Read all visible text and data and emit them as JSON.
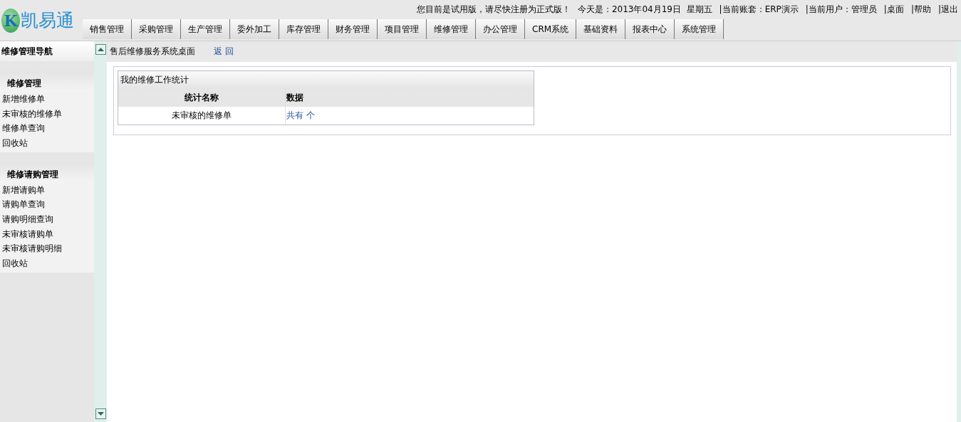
{
  "logo": {
    "letter": "K",
    "name": "凯易通"
  },
  "top_bar": [
    "您目前是试用版，请尽快注册为正式版！",
    "今天是：2013年04月19日  星期五",
    "|当前账套：ERP演示",
    "|当前用户：管理员",
    "|桌面",
    "|帮助",
    "|退出"
  ],
  "tabs": [
    {
      "label": "销售管理",
      "selected": false
    },
    {
      "label": "采购管理",
      "selected": false
    },
    {
      "label": "生产管理",
      "selected": false
    },
    {
      "label": "委外加工",
      "selected": false
    },
    {
      "label": "库存管理",
      "selected": false
    },
    {
      "label": "财务管理",
      "selected": false
    },
    {
      "label": "项目管理",
      "selected": false
    },
    {
      "label": "维修管理",
      "selected": false
    },
    {
      "label": "办公管理",
      "selected": false
    },
    {
      "label": "CRM系统",
      "selected": false
    },
    {
      "label": "基础资料",
      "selected": false
    },
    {
      "label": "报表中心",
      "selected": false
    },
    {
      "label": "系统管理",
      "selected": false
    }
  ],
  "sidebar": {
    "title": "维修管理导航",
    "groups": [
      {
        "title": "维修管理",
        "items": [
          "新增维修单",
          "未审核的维修单",
          "维修单查询",
          "回收站"
        ]
      },
      {
        "title": "维修请购管理",
        "items": [
          "新增请购单",
          "请购单查询",
          "请购明细查询",
          "未审核请购单",
          "未审核请购明细",
          "回收站"
        ]
      }
    ]
  },
  "breadcrumb": {
    "title": "售后维修服务系统桌面",
    "back": "返 回"
  },
  "stats_panel": {
    "title": "我的维修工作统计",
    "columns": [
      "统计名称",
      "数据"
    ],
    "rows": [
      {
        "name": "未审核的维修单",
        "value": "共有 个"
      }
    ]
  }
}
